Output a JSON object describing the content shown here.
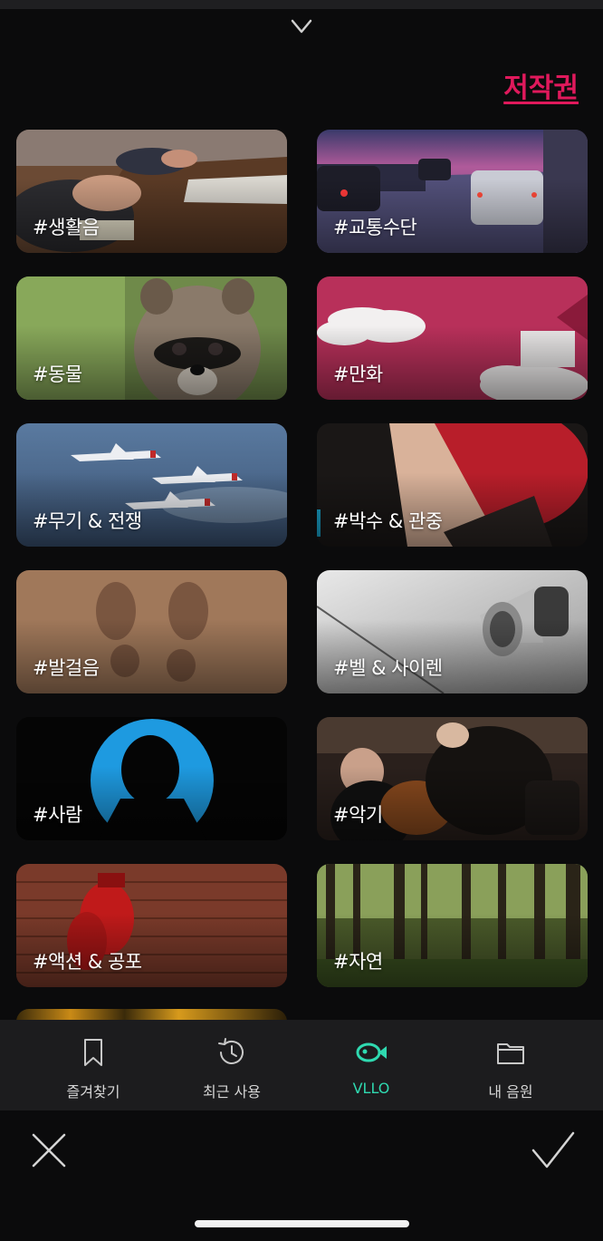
{
  "header": {
    "copyright_label": "저작권"
  },
  "categories": [
    {
      "label": "#생활음",
      "icon": "office-desk-photo"
    },
    {
      "label": "#교통수단",
      "icon": "traffic-highway-photo"
    },
    {
      "label": "#동물",
      "icon": "raccoon-photo"
    },
    {
      "label": "#만화",
      "icon": "comic-wall-photo"
    },
    {
      "label": "#무기 & 전쟁",
      "icon": "fighter-jets-photo"
    },
    {
      "label": "#박수 & 관중",
      "icon": "high-five-photo"
    },
    {
      "label": "#발걸음",
      "icon": "footprints-sand-photo"
    },
    {
      "label": "#벨 & 사이렌",
      "icon": "megaphone-photo"
    },
    {
      "label": "#사람",
      "icon": "person-silhouette-photo"
    },
    {
      "label": "#악기",
      "icon": "cello-orchestra-photo"
    },
    {
      "label": "#액션 & 공포",
      "icon": "boxing-gloves-photo"
    },
    {
      "label": "#자연",
      "icon": "forest-photo"
    }
  ],
  "tabs": [
    {
      "label": "즐겨찾기",
      "icon": "bookmark-icon"
    },
    {
      "label": "최근 사용",
      "icon": "history-icon"
    },
    {
      "label": "VLLO",
      "icon": "vllo-fish-icon",
      "active": true
    },
    {
      "label": "내 음원",
      "icon": "folder-icon"
    }
  ],
  "colors": {
    "accent": "#2fd9b0",
    "copyright": "#e0195c",
    "background": "#0b0b0c"
  }
}
